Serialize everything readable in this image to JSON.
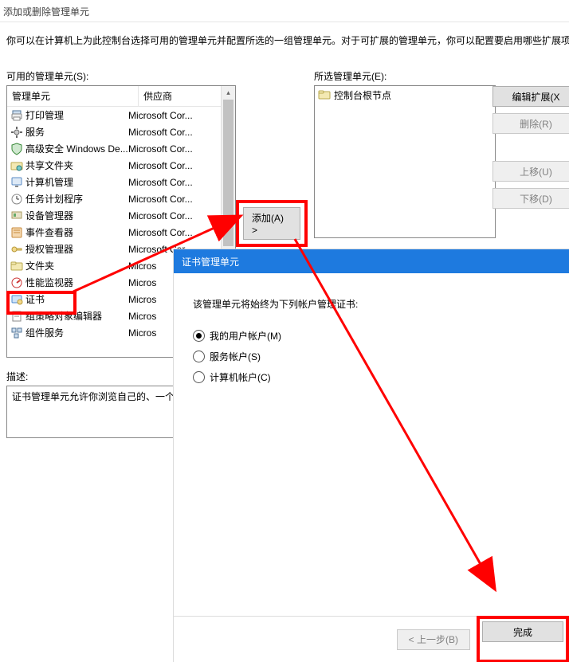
{
  "dialog": {
    "title": "添加或删除管理单元",
    "intro": "你可以在计算机上为此控制台选择可用的管理单元并配置所选的一组管理单元。对于可扩展的管理单元，你可以配置要启用哪些扩展项",
    "available_label": "可用的管理单元(S):",
    "selected_label": "所选管理单元(E):",
    "desc_label": "描述:",
    "desc_text": "证书管理单元允许你浏览自己的、一个",
    "header_col1": "管理单元",
    "header_col2": "供应商",
    "root_node": "控制台根节点",
    "items": [
      {
        "icon": "printer-icon",
        "name": "打印管理",
        "vendor": "Microsoft Cor..."
      },
      {
        "icon": "gear-icon",
        "name": "服务",
        "vendor": "Microsoft Cor..."
      },
      {
        "icon": "shield-icon",
        "name": "高级安全 Windows De...",
        "vendor": "Microsoft Cor..."
      },
      {
        "icon": "folder-share-icon",
        "name": "共享文件夹",
        "vendor": "Microsoft Cor..."
      },
      {
        "icon": "monitor-icon",
        "name": "计算机管理",
        "vendor": "Microsoft Cor..."
      },
      {
        "icon": "clock-icon",
        "name": "任务计划程序",
        "vendor": "Microsoft Cor..."
      },
      {
        "icon": "device-icon",
        "name": "设备管理器",
        "vendor": "Microsoft Cor..."
      },
      {
        "icon": "event-icon",
        "name": "事件查看器",
        "vendor": "Microsoft Cor..."
      },
      {
        "icon": "key-icon",
        "name": "授权管理器",
        "vendor": "Microsoft Cor..."
      },
      {
        "icon": "folder-icon",
        "name": "文件夹",
        "vendor": "Micros"
      },
      {
        "icon": "perf-icon",
        "name": "性能监视器",
        "vendor": "Micros"
      },
      {
        "icon": "cert-icon",
        "name": "证书",
        "vendor": "Micros"
      },
      {
        "icon": "policy-icon",
        "name": "组策略对象编辑器",
        "vendor": "Micros"
      },
      {
        "icon": "component-icon",
        "name": "组件服务",
        "vendor": "Micros"
      }
    ],
    "buttons": {
      "add": "添加(A) >",
      "edit_ext": "编辑扩展(X",
      "remove": "删除(R)",
      "move_up": "上移(U)",
      "move_down": "下移(D)"
    }
  },
  "dialog2": {
    "title": "证书管理单元",
    "prompt": "该管理单元将始终为下列帐户管理证书:",
    "options": [
      {
        "label": "我的用户帐户(M)",
        "checked": true
      },
      {
        "label": "服务帐户(S)",
        "checked": false
      },
      {
        "label": "计算机帐户(C)",
        "checked": false
      }
    ],
    "back": "< 上一步(B)",
    "finish": "完成"
  },
  "colors": {
    "highlight": "#ff0000",
    "titlebar": "#1e7adf"
  }
}
